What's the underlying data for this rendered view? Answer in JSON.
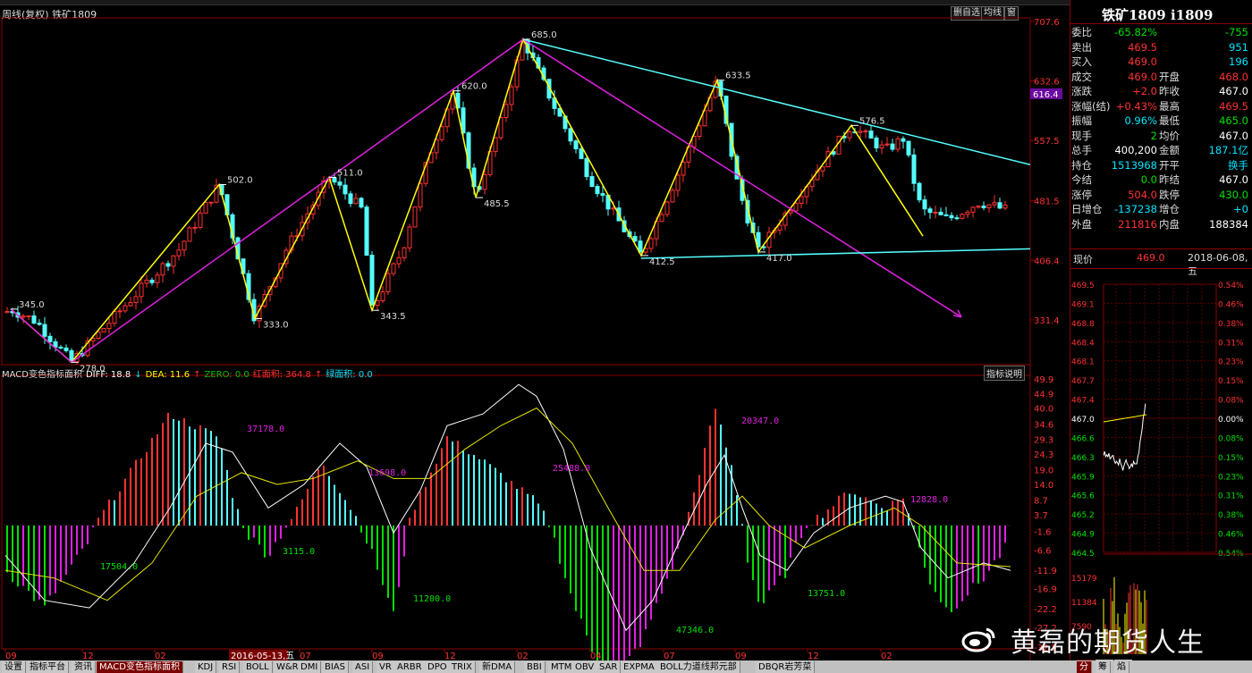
{
  "header": {
    "title": "周线(复权) 铁矿1809",
    "buttons": [
      "删自选",
      "均线",
      "窗"
    ]
  },
  "chart_data": {
    "type": "candlestick",
    "title": "铁矿1809",
    "price_axis": {
      "ticks": [
        707.6,
        632.6,
        557.5,
        481.5,
        406.4,
        331.4
      ],
      "current_label": 616.4,
      "ylim": [
        275,
        712
      ]
    },
    "time_axis": {
      "ticks": [
        "09",
        "12",
        "02",
        "2016-05-13,五",
        "07",
        "09",
        "12",
        "02",
        "04",
        "07",
        "09",
        "12",
        "02"
      ]
    },
    "candles_hint": "weekly candles, swing points annotated",
    "swing_points": [
      {
        "label": "345.0",
        "price": 345.0
      },
      {
        "label": "278.0",
        "price": 278.0
      },
      {
        "label": "502.0",
        "price": 502.0
      },
      {
        "label": "333.0",
        "price": 333.0
      },
      {
        "label": "511.0",
        "price": 511.0
      },
      {
        "label": "343.5",
        "price": 343.5
      },
      {
        "label": "620.0",
        "price": 620.0
      },
      {
        "label": "485.5",
        "price": 485.5
      },
      {
        "label": "685.0",
        "price": 685.0
      },
      {
        "label": "412.5",
        "price": 412.5
      },
      {
        "label": "633.5",
        "price": 633.5
      },
      {
        "label": "417.0",
        "price": 417.0
      },
      {
        "label": "576.5",
        "price": 576.5
      }
    ],
    "indicator": {
      "name": "MACD变色指标面积",
      "legend": [
        {
          "text": "MACD变色指标面积",
          "color": "#dddddd"
        },
        {
          "text": "DIFF: 18.8",
          "color": "#ffffff"
        },
        {
          "text": "↓",
          "color": "#00e5ff"
        },
        {
          "text": "DEA: 11.6",
          "color": "#ffff00"
        },
        {
          "text": "↑",
          "color": "#ff3232"
        },
        {
          "text": "ZERO: 0.0",
          "color": "#00c000"
        },
        {
          "text": "红面积: 364.8",
          "color": "#ff3232"
        },
        {
          "text": "↑",
          "color": "#ff3232"
        },
        {
          "text": "绿面积: 0.0",
          "color": "#00e5ff"
        }
      ],
      "button": "指标说明",
      "ticks": [
        49.9,
        44.9,
        40.0,
        34.6,
        29.3,
        24.3,
        19.0,
        14.0,
        8.7,
        3.7,
        -1.6,
        -6.6,
        -11.9,
        -16.9,
        -22.2,
        -27.2,
        -32.5
      ],
      "area_labels": [
        {
          "text": "17504.0",
          "color": "#00e000"
        },
        {
          "text": "37178.0",
          "color": "#e020e0"
        },
        {
          "text": "3115.0",
          "color": "#00e000"
        },
        {
          "text": "13698.0",
          "color": "#e020e0"
        },
        {
          "text": "11200.0",
          "color": "#00e000"
        },
        {
          "text": "25488.0",
          "color": "#e020e0"
        },
        {
          "text": "47346.0",
          "color": "#00e000"
        },
        {
          "text": "20347.0",
          "color": "#e020e0"
        },
        {
          "text": "13751.0",
          "color": "#00e000"
        },
        {
          "text": "12828.0",
          "color": "#e020e0"
        }
      ]
    }
  },
  "quote": {
    "title": "铁矿1809 i1809",
    "rows": [
      {
        "l1": "委比",
        "v1": "-65.82%",
        "c1": "green",
        "v2": "-755",
        "c2": "green"
      },
      {
        "l1": "卖出",
        "v1": "469.5",
        "c1": "red",
        "v2": "951",
        "c2": "cyan"
      },
      {
        "l1": "买入",
        "v1": "469.0",
        "c1": "red",
        "v2": "196",
        "c2": "cyan"
      },
      {
        "l1": "成交",
        "v1": "469.0",
        "c1": "red",
        "l2": "开盘",
        "v2": "468.0",
        "c2": "red"
      },
      {
        "l1": "涨跌",
        "v1": "+2.0",
        "c1": "red",
        "l2": "昨收",
        "v2": "467.0",
        "c2": "white"
      },
      {
        "l1": "涨幅(结)",
        "v1": "+0.43%",
        "c1": "red",
        "l2": "最高",
        "v2": "469.5",
        "c2": "red"
      },
      {
        "l1": "振幅",
        "v1": "0.96%",
        "c1": "cyan",
        "l2": "最低",
        "v2": "465.0",
        "c2": "green"
      },
      {
        "l1": "现手",
        "v1": "2",
        "c1": "green",
        "l2": "均价",
        "v2": "467.0",
        "c2": "white"
      },
      {
        "l1": "总手",
        "v1": "400,200",
        "c1": "white",
        "l2": "金额",
        "v2": "187.1亿",
        "c2": "cyan"
      },
      {
        "l1": "持仓",
        "v1": "1513968",
        "c1": "cyan",
        "l2": "开平",
        "v2": "换手",
        "c2": "cyan"
      },
      {
        "l1": "今结",
        "v1": "0.0",
        "c1": "green",
        "l2": "昨结",
        "v2": "467.0",
        "c2": "white"
      },
      {
        "l1": "涨停",
        "v1": "504.0",
        "c1": "red",
        "l2": "跌停",
        "v2": "430.0",
        "c2": "green"
      },
      {
        "l1": "日增仓",
        "v1": "-137238",
        "c1": "cyan",
        "l2": "增仓",
        "v2": "+0",
        "c2": "cyan"
      },
      {
        "l1": "外盘",
        "v1": "211816",
        "c1": "red",
        "l2": "内盘",
        "v2": "188384",
        "c2": "white"
      }
    ],
    "current_price_label": "现价",
    "current_price": "469.0",
    "date": "2018-06-08,五",
    "mini_price_ticks": [
      "469.5",
      "469.1",
      "468.8",
      "468.4",
      "468.1",
      "467.7",
      "467.4",
      "467.0",
      "466.6",
      "466.3",
      "465.9",
      "465.6",
      "465.2",
      "464.9",
      "464.5"
    ],
    "mini_pct_ticks": [
      "0.54%",
      "0.46%",
      "0.38%",
      "0.31%",
      "0.23%",
      "0.15%",
      "0.08%",
      "0.00%",
      "0.08%",
      "0.15%",
      "0.23%",
      "0.31%",
      "0.38%",
      "0.46%",
      "0.54%"
    ],
    "vol_ticks": [
      "15179",
      "11384",
      "7590"
    ],
    "bottom_tabs": [
      "分",
      "筹",
      "焰"
    ]
  },
  "tabs": [
    "设置",
    "指标平台",
    "资讯",
    "MACD变色指标面积",
    "KDJ",
    "RSI",
    "BOLL",
    "W&R",
    "DMI",
    "BIAS",
    "ASI",
    "VR",
    "ARBR",
    "DPO",
    "TRIX",
    "新DMA",
    "BBI",
    "MTM",
    "OBV",
    "SAR",
    "EXPMA",
    "BOLL力道线邦元部",
    "DBQR岩芳菜"
  ],
  "watermark": "黄磊的期货人生"
}
